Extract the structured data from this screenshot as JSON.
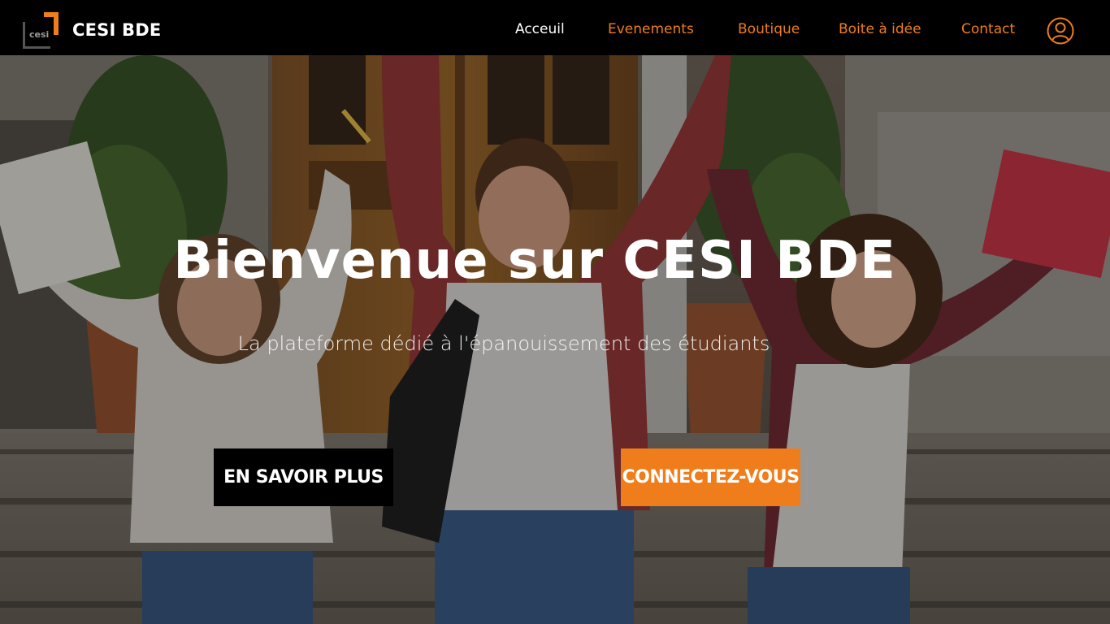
{
  "brand": {
    "name": "CESI BDE",
    "logo_text": "cesi"
  },
  "nav": {
    "items": [
      {
        "label": "Acceuil",
        "active": true
      },
      {
        "label": "Evenements",
        "active": false
      },
      {
        "label": "Boutique",
        "active": false
      },
      {
        "label": "Boite à idée",
        "active": false
      },
      {
        "label": "Contact",
        "active": false
      }
    ],
    "user_icon": "user-account-icon"
  },
  "hero": {
    "title": "Bienvenue sur CESI BDE",
    "subtitle": "La plateforme dédié à l'épanouissement des étudiants",
    "primary_button": "EN SAVOIR PLUS",
    "secondary_button": "CONNECTEZ-VOUS"
  },
  "colors": {
    "accent": "#f07d1b",
    "navbar_bg": "#000000",
    "text": "#ffffff"
  }
}
